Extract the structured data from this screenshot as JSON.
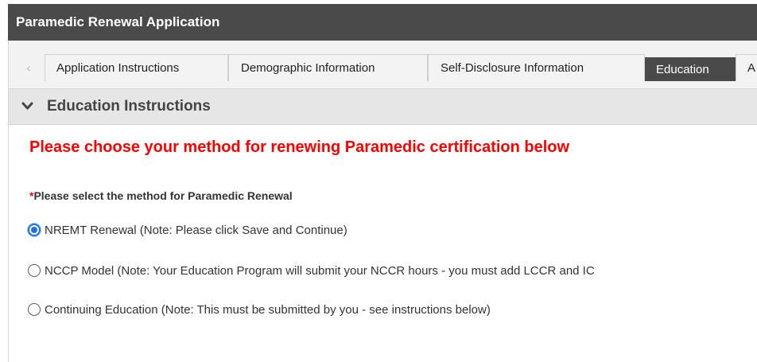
{
  "app": {
    "title": "Paramedic Renewal Application"
  },
  "tabs": {
    "scroll_left_icon": "chevron-left-icon",
    "items": [
      {
        "label": "Application Instructions",
        "active": false
      },
      {
        "label": "Demographic Information",
        "active": false
      },
      {
        "label": "Self-Disclosure Information",
        "active": false
      },
      {
        "label": "Education",
        "active": true
      },
      {
        "label": "A",
        "active": false
      }
    ]
  },
  "section": {
    "icon": "chevron-down-icon",
    "title": "Education Instructions"
  },
  "form": {
    "heading": "Please choose your method for renewing Paramedic certification below",
    "question": {
      "required_marker": "*",
      "label": "Please select the method for Paramedic Renewal"
    },
    "options": [
      {
        "label": "NREMT Renewal (Note: Please click Save and Continue)",
        "selected": true
      },
      {
        "label": "NCCP Model (Note: Your Education Program will submit your NCCR hours - you must add LCCR and IC",
        "selected": false
      },
      {
        "label": "Continuing Education (Note: This must be submitted by you - see instructions below)",
        "selected": false
      }
    ]
  },
  "colors": {
    "title_bar": "#4a4a4a",
    "active_tab": "#4a4a4a",
    "heading_red": "#ff0000",
    "radio_selected": "#1a73e8"
  }
}
